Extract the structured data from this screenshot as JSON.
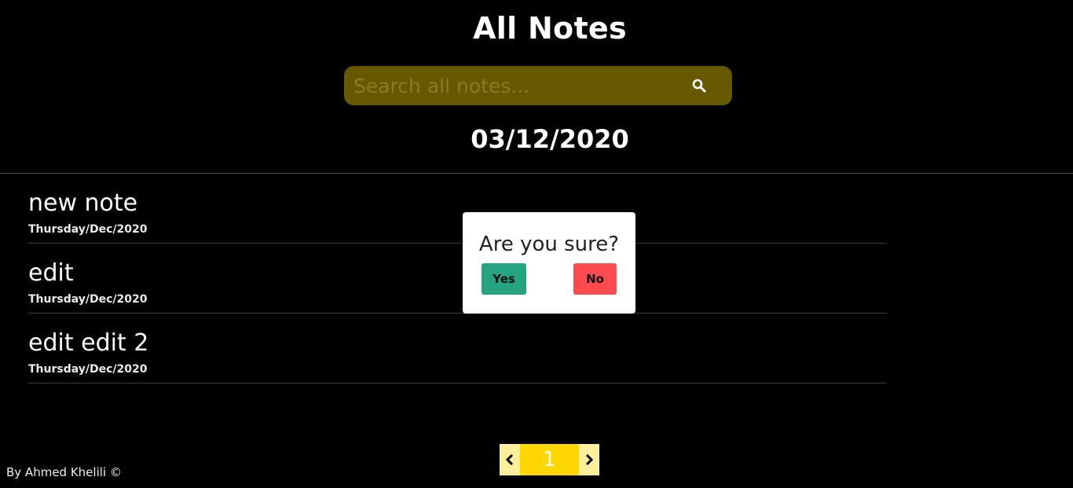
{
  "header": {
    "title": "All Notes"
  },
  "search": {
    "placeholder": "Search all notes...",
    "value": ""
  },
  "date_heading": "03/12/2020",
  "notes": [
    {
      "title": "new note",
      "date": "Thursday/Dec/2020"
    },
    {
      "title": "edit",
      "date": "Thursday/Dec/2020"
    },
    {
      "title": "edit edit 2",
      "date": "Thursday/Dec/2020"
    }
  ],
  "confirm_dialog": {
    "question": "Are you sure?",
    "yes_label": "Yes",
    "no_label": "No"
  },
  "pagination": {
    "current_page": "1"
  },
  "footer": {
    "credit": "By Ahmed Khelili ©"
  },
  "colors": {
    "background": "#000000",
    "search_bg": "#665800",
    "yes_button": "#26a482",
    "no_button": "#fb4b4e",
    "page_active": "#ffd700",
    "page_arrow": "#fdef9b"
  },
  "icons": {
    "search": "search-icon",
    "prev": "chevron-left-icon",
    "next": "chevron-right-icon"
  }
}
